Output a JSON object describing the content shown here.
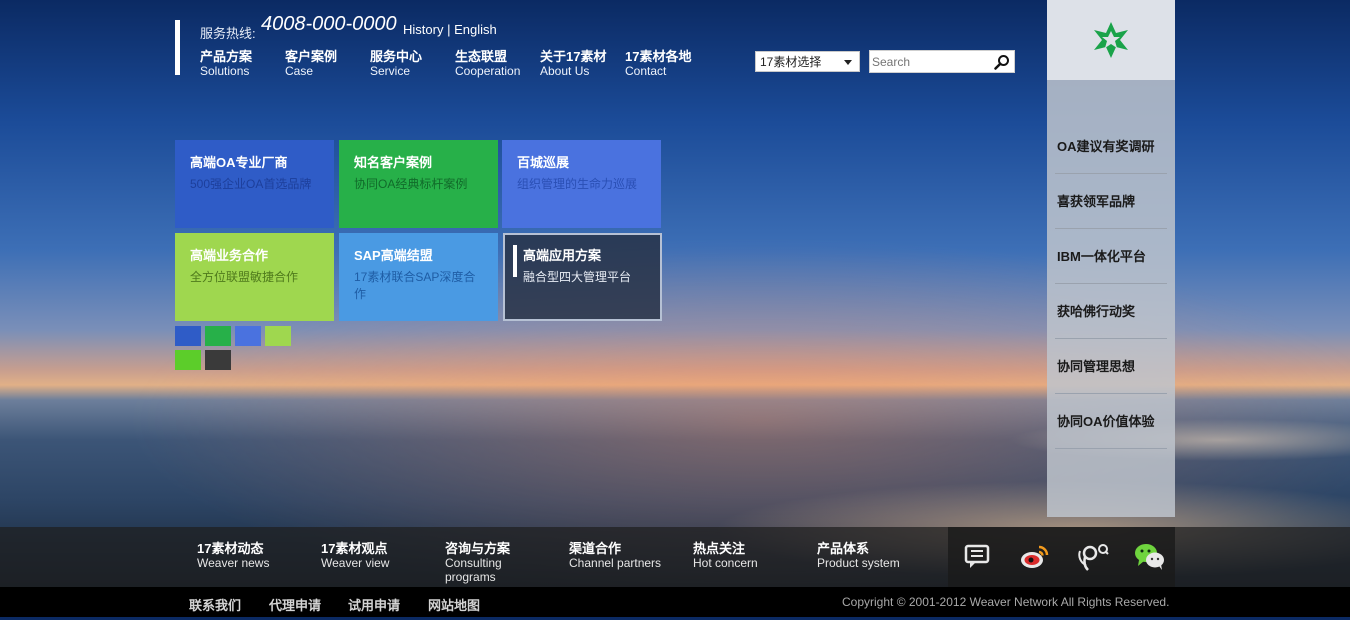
{
  "header": {
    "hotline_label": "服务热线:",
    "hotline_number": "4008-000-0000",
    "lang_history": "History",
    "lang_sep": " | ",
    "lang_english": "English"
  },
  "nav": [
    {
      "cn": "产品方案",
      "en": "Solutions"
    },
    {
      "cn": "客户案例",
      "en": "Case"
    },
    {
      "cn": "服务中心",
      "en": "Service"
    },
    {
      "cn": "生态联盟",
      "en": "Cooperation"
    },
    {
      "cn": "关于17素材",
      "en": "About Us"
    },
    {
      "cn": "17素材各地",
      "en": "Contact"
    }
  ],
  "site_select": {
    "value": "17素材选择"
  },
  "search": {
    "placeholder": "Search"
  },
  "tiles": [
    {
      "title": "高端OA专业厂商",
      "sub": "500强企业OA首选品牌"
    },
    {
      "title": "知名客户案例",
      "sub": "协同OA经典标杆案例"
    },
    {
      "title": "百城巡展",
      "sub": "组织管理的生命力巡展"
    },
    {
      "title": "高端业务合作",
      "sub": "全方位联盟敏捷合作"
    },
    {
      "title": "SAP高端结盟",
      "sub": "17素材联合SAP深度合作"
    },
    {
      "title": "高端应用方案",
      "sub": "融合型四大管理平台"
    }
  ],
  "swatches": [
    "#2f5cc7",
    "#27b049",
    "#4a72df",
    "#9fd74f",
    "#5ccd2a",
    "#3a3a3a"
  ],
  "sidebar": {
    "items": [
      "OA建议有奖调研",
      "喜获领军品牌",
      "IBM一体化平台",
      "获哈佛行动奖",
      "协同管理思想",
      "协同OA价值体验"
    ]
  },
  "bottom_links": [
    {
      "cn": "17素材动态",
      "en": "Weaver news"
    },
    {
      "cn": "17素材观点",
      "en": "Weaver view"
    },
    {
      "cn": "咨询与方案",
      "en": "Consulting programs"
    },
    {
      "cn": "渠道合作",
      "en": "Channel partners"
    },
    {
      "cn": "热点关注",
      "en": "Hot concern"
    },
    {
      "cn": "产品体系",
      "en": "Product system"
    }
  ],
  "social_icons": [
    "chat-icon",
    "weibo-icon",
    "tencent-weibo-icon",
    "wechat-icon"
  ],
  "footer": {
    "links": [
      "联系我们",
      "代理申请",
      "试用申请",
      "网站地图"
    ],
    "copyright": "Copyright © 2001-2012 Weaver Network All Rights Reserved."
  }
}
